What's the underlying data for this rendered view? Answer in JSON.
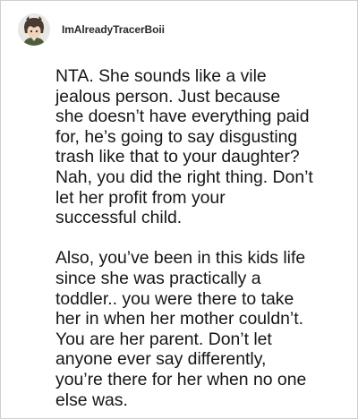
{
  "comment": {
    "username": "ImAlreadyTracerBoii",
    "avatar": "anime-character-avatar",
    "paragraphs": [
      "NTA. She sounds like a vile\njealous person. Just because\nshe doesn’t have everything paid\nfor, he’s going to say disgusting\ntrash like that to your daughter?\nNah, you did the right thing. Don’t\nlet her profit from your\nsuccessful child.",
      "Also, you’ve been in this kids life\nsince she was practically a\ntoddler.. you were there to take\nher in when her mother couldn’t.\nYou are her parent. Don’t let\nanyone ever say differently,\nyou’re there for her when no one\nelse was."
    ]
  }
}
